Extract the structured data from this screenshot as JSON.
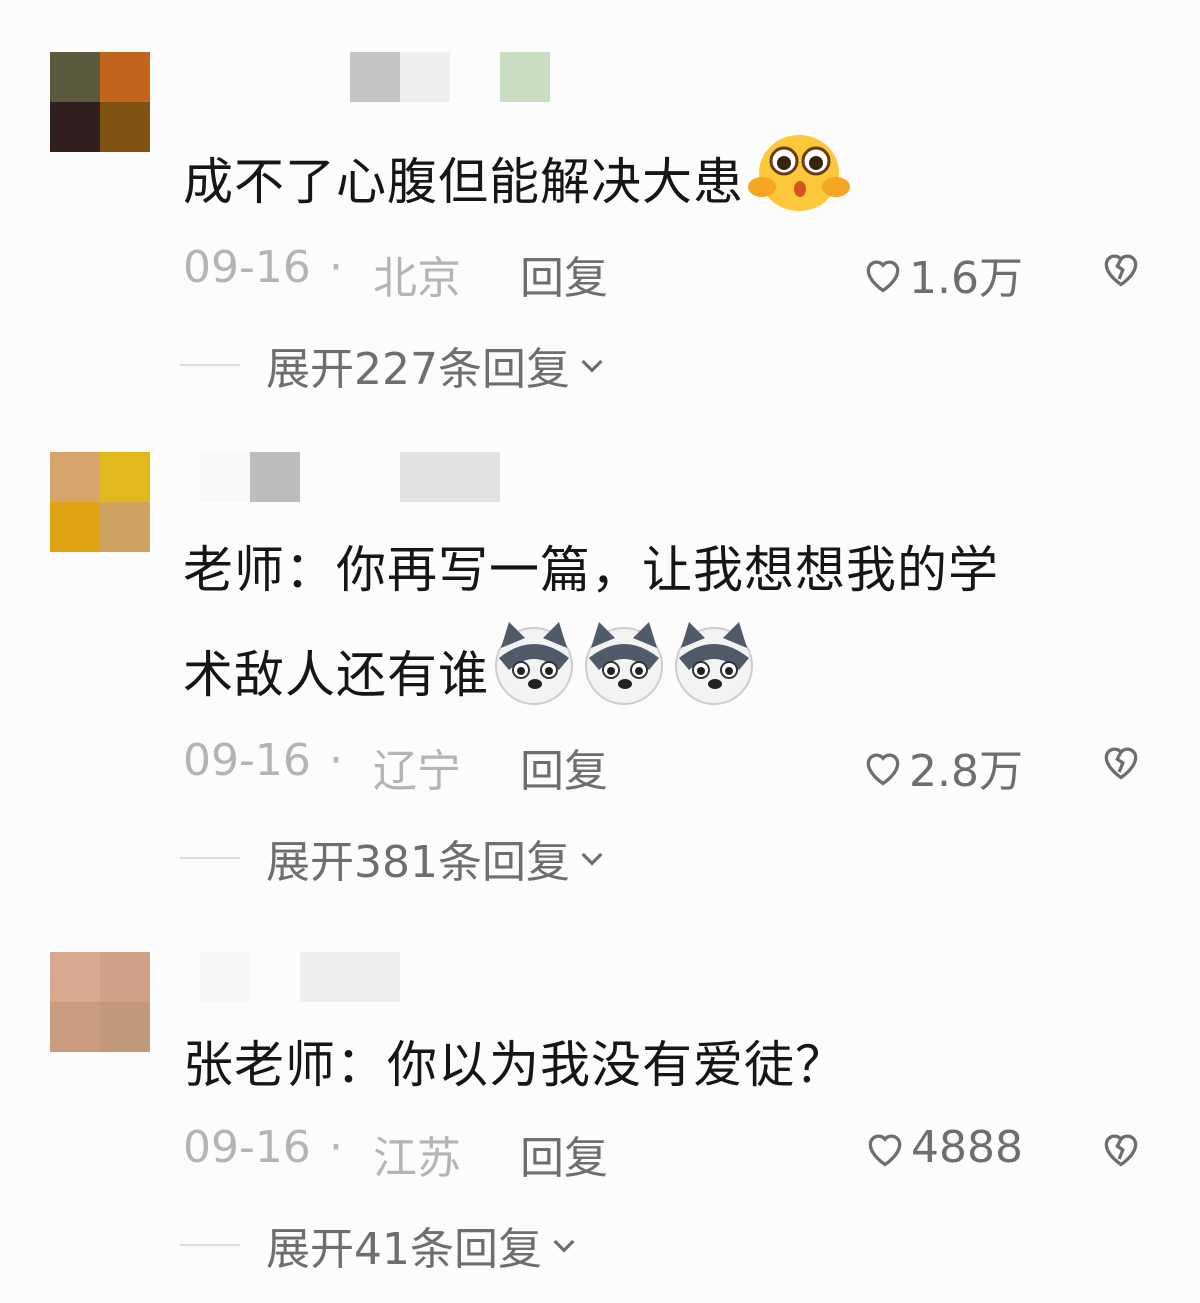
{
  "comments": [
    {
      "avatar_colors": [
        "#5c5a3c",
        "#c4651f",
        "#311f1f",
        "#7f5210"
      ],
      "name_block_colors": [
        "#c4c4c6",
        "#eeeeee",
        "#c8ddc2"
      ],
      "text": "成不了心腹但能解决大患",
      "emojis": [
        "crying-face-icon"
      ],
      "date": "09-16",
      "location": "北京",
      "reply_label": "回复",
      "likes": "1.6万",
      "expand_label": "展开227条回复"
    },
    {
      "avatar_colors": [
        "#d7a46c",
        "#e2b91c",
        "#dfa212",
        "#cda35f"
      ],
      "name_block_colors": [
        "#f8f8f8",
        "#bcbcbc",
        "#e2e2e2"
      ],
      "text_line1": "老师：你再写一篇，让我想想我的学",
      "text_line2": "术敌人还有谁",
      "emojis": [
        "dog-face-icon",
        "dog-face-icon",
        "dog-face-icon"
      ],
      "date": "09-16",
      "location": "辽宁",
      "reply_label": "回复",
      "likes": "2.8万",
      "expand_label": "展开381条回复"
    },
    {
      "avatar_colors": [
        "#d7a78f",
        "#cfa087",
        "#c99b7f",
        "#c3987a"
      ],
      "name_block_colors": [
        "#f6f6f6",
        "#eeeeee"
      ],
      "text": "张老师：你以为我没有爱徒？",
      "emojis": [],
      "date": "09-16",
      "location": "江苏",
      "reply_label": "回复",
      "likes": "4888",
      "expand_label": "展开41条回复"
    }
  ],
  "separator": "·",
  "colors": {
    "text": "#161616",
    "meta": "#b4b4b4",
    "secondary": "#6e6e6e"
  }
}
